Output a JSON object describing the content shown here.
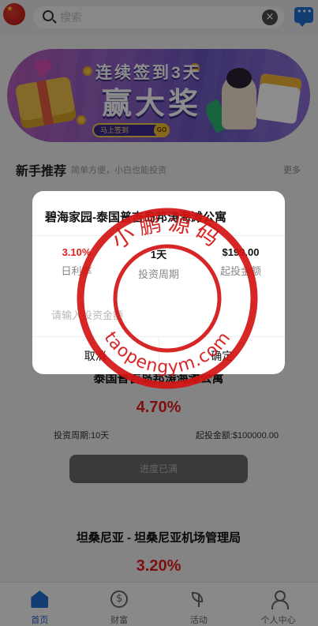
{
  "header": {
    "search_placeholder": "搜索",
    "clear_icon": "×"
  },
  "banner": {
    "line1": "连续签到3天",
    "line2": "赢大奖",
    "cta": "马上签到",
    "go": "GO"
  },
  "section": {
    "title": "新手推荐",
    "subtitle": "简单方便，小白也能投资",
    "more": "更多"
  },
  "products": [
    {
      "title": "泰国普吉岛邦涛海滩公寓",
      "rate": "4.70%",
      "period": "投资周期:10天",
      "min": "起投金额:$100000.00",
      "button": "进度已满"
    },
    {
      "title": "坦桑尼亚 - 坦桑尼亚机场管理局",
      "rate": "3.20%"
    }
  ],
  "nav": {
    "items": [
      {
        "label": "首页",
        "icon": "home-icon",
        "active": true
      },
      {
        "label": "财富",
        "icon": "money-icon",
        "active": false
      },
      {
        "label": "活动",
        "icon": "sprout-icon",
        "active": false
      },
      {
        "label": "个人中心",
        "icon": "user-icon",
        "active": false
      }
    ]
  },
  "modal": {
    "title": "碧海家园-泰国普吉岛邦涛海滩公寓",
    "stats": [
      {
        "value": "3.10%",
        "label": "日利率"
      },
      {
        "value": "1天",
        "label": "投资周期"
      },
      {
        "value": "$199.00",
        "label": "起投金额"
      }
    ],
    "input_placeholder": "请输入投资金额",
    "cancel": "取消",
    "confirm": "确定"
  },
  "watermark": {
    "top_text": "小鹏源码",
    "bottom_text": "taopengym.com"
  },
  "colors": {
    "accent": "#1f6fd1",
    "rate_red": "#e61c1c",
    "stamp_red": "#d41414"
  }
}
